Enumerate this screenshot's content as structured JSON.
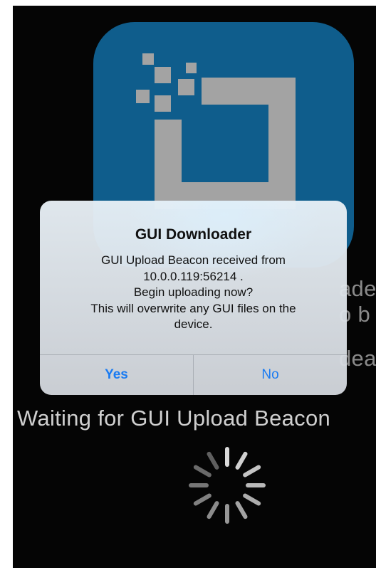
{
  "background": {
    "lines": [
      "ade",
      "o b",
      "dea"
    ],
    "waiting_text": "Waiting for GUI Upload Beacon"
  },
  "alert": {
    "title": "GUI Downloader",
    "message_lines": [
      "GUI Upload Beacon received from",
      "10.0.0.119:56214 .",
      "Begin uploading now?",
      "This will overwrite any GUI files on the",
      "device."
    ],
    "yes_label": "Yes",
    "no_label": "No"
  },
  "colors": {
    "icon_background": "#0f5d8c",
    "logo_gray": "#a3a3a3",
    "button_blue": "#1a7bf2"
  },
  "icons": {
    "app_icon": "downloader-app-icon",
    "spinner": "activity-spinner-icon"
  }
}
